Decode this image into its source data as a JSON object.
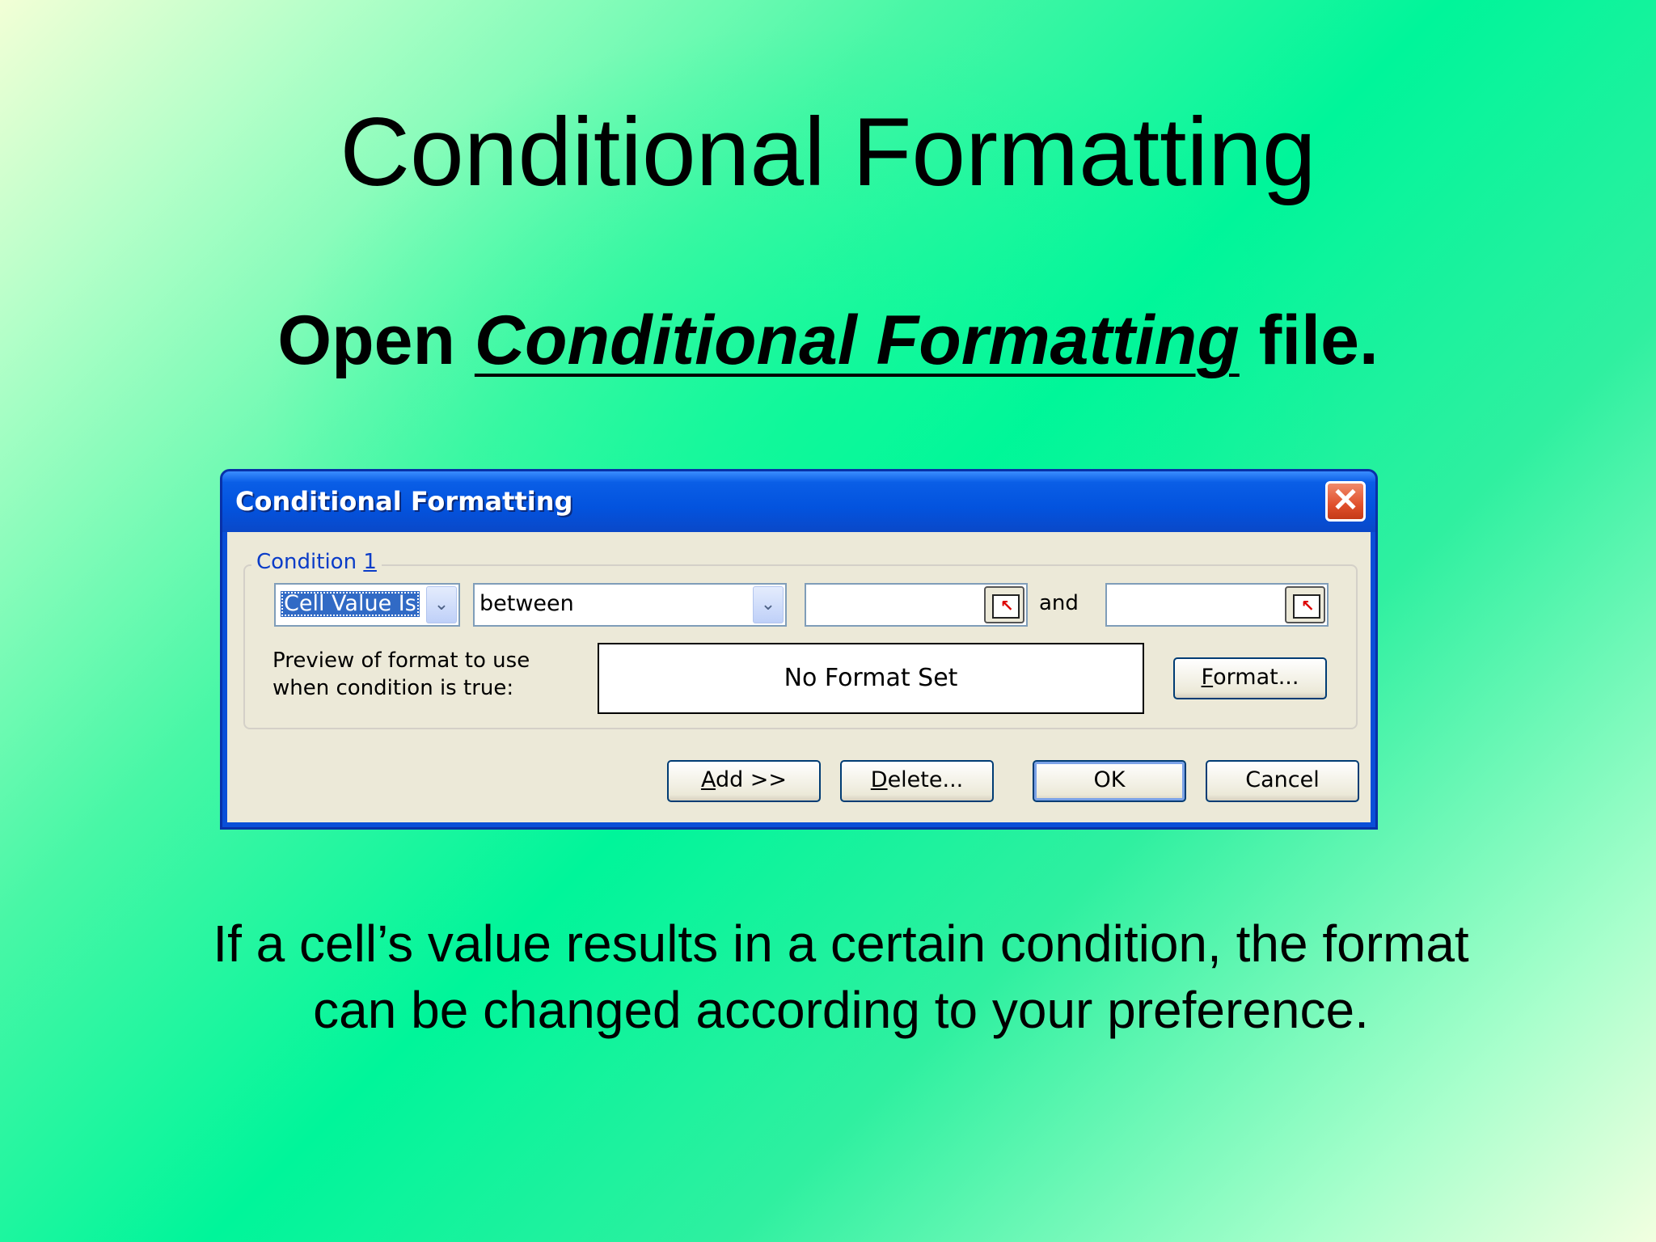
{
  "slide": {
    "title": "Conditional Formatting",
    "subtitle_prefix": "Open ",
    "subtitle_emphasis": "Conditional Formatting",
    "subtitle_suffix": " file.",
    "caption": "If a cell’s value results in a certain condition, the format can be changed according to your preference."
  },
  "dialog": {
    "title": "Conditional Formatting",
    "close_icon": "close-icon",
    "group_label": "Condition ",
    "group_number": "1",
    "condition_type": "Cell Value Is",
    "operator": "between",
    "value1": "",
    "and_label": "and",
    "value2": "",
    "preview_label_line1": "Preview of format to use",
    "preview_label_line2": "when condition is true:",
    "preview_text": "No Format Set",
    "format_button": {
      "mnemonic": "F",
      "rest": "ormat..."
    },
    "add_button": {
      "mnemonic": "A",
      "rest": "dd >>"
    },
    "delete_button": {
      "mnemonic": "D",
      "rest": "elete..."
    },
    "ok_button": "OK",
    "cancel_button": "Cancel"
  },
  "colors": {
    "titlebar": "#0353de",
    "dialog_face": "#ece9d8",
    "selection": "#316ac5",
    "close_button": "#e0502c"
  }
}
